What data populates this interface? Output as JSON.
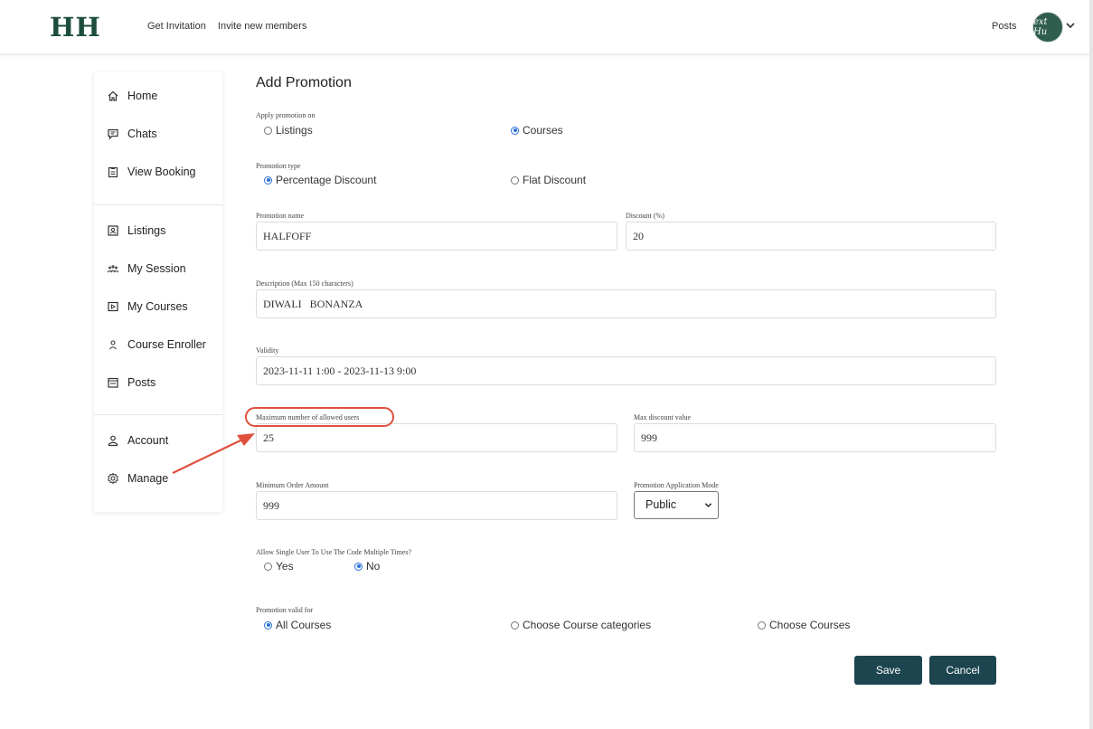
{
  "header": {
    "logo": "HH",
    "nav": [
      "Get Invitation",
      "Invite new members"
    ],
    "posts": "Posts",
    "avatar_text": "ext Hu"
  },
  "sidebar": {
    "group1": [
      {
        "label": "Home",
        "icon": "home-icon"
      },
      {
        "label": "Chats",
        "icon": "chat-icon"
      },
      {
        "label": "View Booking",
        "icon": "clipboard-icon"
      }
    ],
    "group2": [
      {
        "label": "Listings",
        "icon": "listing-icon"
      },
      {
        "label": "My Session",
        "icon": "group-icon"
      },
      {
        "label": "My Courses",
        "icon": "play-icon"
      },
      {
        "label": "Course Enroller",
        "icon": "user-icon"
      },
      {
        "label": "Posts",
        "icon": "posts-icon"
      }
    ],
    "group3": [
      {
        "label": "Account",
        "icon": "account-icon"
      },
      {
        "label": "Manage",
        "icon": "gear-icon"
      }
    ]
  },
  "form": {
    "title": "Add Promotion",
    "apply_on": {
      "label": "Apply promotion on",
      "options": [
        "Listings",
        "Courses"
      ],
      "selected": "Courses"
    },
    "promo_type": {
      "label": "Promotion type",
      "options": [
        "Percentage Discount",
        "Flat Discount"
      ],
      "selected": "Percentage Discount"
    },
    "promo_name": {
      "label": "Promotion name",
      "value": "HALFOFF"
    },
    "discount": {
      "label": "Discount (%)",
      "value": "20"
    },
    "description": {
      "label": "Description (Max 150 characters)",
      "value": "DIWALI   BONANZA"
    },
    "validity": {
      "label": "Validity",
      "value": "2023-11-11 1:00 - 2023-11-13 9:00"
    },
    "max_users": {
      "label": "Maximum number of allowed users",
      "value": "25"
    },
    "max_discount": {
      "label": "Max discount value",
      "value": "999"
    },
    "min_order": {
      "label": "Minimum Order Amount",
      "value": "999"
    },
    "application_mode": {
      "label": "Promotion Application Mode",
      "value": "Public"
    },
    "multi_use": {
      "label": "Allow Single User To Use The Code Multiple Times?",
      "options": [
        "Yes",
        "No"
      ],
      "selected": "No"
    },
    "valid_for": {
      "label": "Promotion valid for",
      "options": [
        "All Courses",
        "Choose Course categories",
        "Choose Courses"
      ],
      "selected": "All Courses"
    },
    "save": "Save",
    "cancel": "Cancel"
  },
  "colors": {
    "brand": "#1d4d3f",
    "button": "#1d4550",
    "annotation": "#e0503e",
    "radio": "#2a6fd6"
  }
}
